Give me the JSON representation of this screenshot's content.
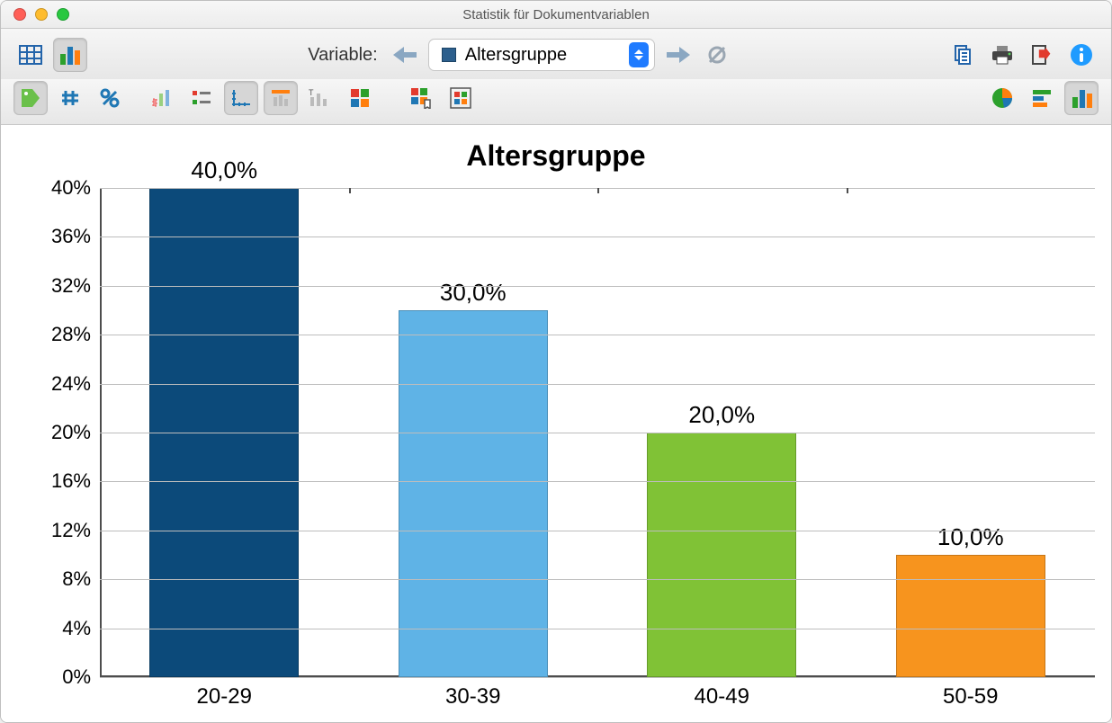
{
  "window": {
    "title": "Statistik für Dokumentvariablen"
  },
  "toolbar1": {
    "variable_label": "Variable:",
    "select_value": "Altersgruppe"
  },
  "chart_data": {
    "type": "bar",
    "title": "Altersgruppe",
    "xlabel": "",
    "ylabel": "",
    "categories": [
      "20-29",
      "30-39",
      "40-49",
      "50-59"
    ],
    "values": [
      40.0,
      30.0,
      20.0,
      10.0
    ],
    "value_labels": [
      "40,0%",
      "30,0%",
      "20,0%",
      "10,0%"
    ],
    "colors": [
      "#0c4a7a",
      "#5fb3e6",
      "#80c236",
      "#f7941e"
    ],
    "ylim": [
      0,
      40
    ],
    "y_ticks": [
      0,
      4,
      8,
      12,
      16,
      20,
      24,
      28,
      32,
      36,
      40
    ],
    "y_tick_labels": [
      "0%",
      "4%",
      "8%",
      "12%",
      "16%",
      "20%",
      "24%",
      "28%",
      "32%",
      "36%",
      "40%"
    ]
  },
  "icons": {
    "tag": "tag-icon",
    "hash": "hash-icon",
    "percent": "percent-icon"
  }
}
